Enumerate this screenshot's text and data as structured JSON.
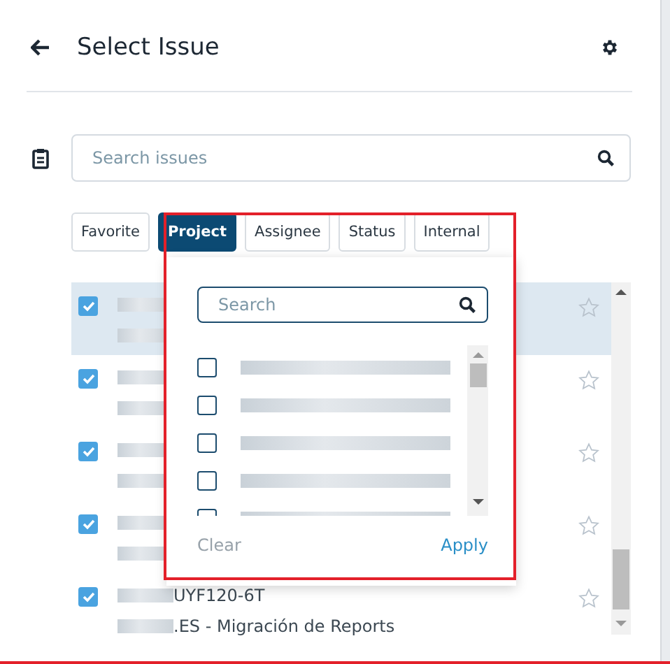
{
  "header": {
    "title": "Select Issue"
  },
  "search": {
    "placeholder": "Search issues"
  },
  "filters": [
    {
      "label": "Favorite",
      "selected": false
    },
    {
      "label": "Project",
      "selected": true
    },
    {
      "label": "Assignee",
      "selected": false
    },
    {
      "label": "Status",
      "selected": false
    },
    {
      "label": "Internal",
      "selected": false
    }
  ],
  "issues": [
    {
      "checked": true,
      "selected": true,
      "favorite": false
    },
    {
      "checked": true,
      "selected": false,
      "favorite": false
    },
    {
      "checked": true,
      "selected": false,
      "favorite": false
    },
    {
      "checked": true,
      "selected": false,
      "favorite": false
    },
    {
      "checked": true,
      "selected": false,
      "favorite": false,
      "key": "UYF120-6T",
      "summary": ".ES - Migración de Reports"
    }
  ],
  "dropdown": {
    "search_placeholder": "Search",
    "options": [
      {
        "checked": false
      },
      {
        "checked": false
      },
      {
        "checked": false
      },
      {
        "checked": false
      },
      {
        "checked": false
      }
    ],
    "clear": "Clear",
    "apply": "Apply"
  }
}
